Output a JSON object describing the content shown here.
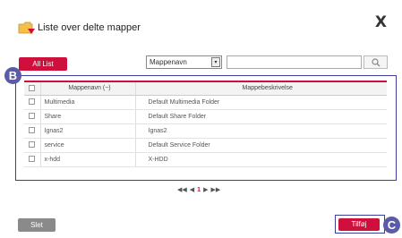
{
  "dialog": {
    "title": "Liste over delte mapper",
    "close_label": "X"
  },
  "toolbar": {
    "all_list_label": "All List",
    "filter_select_value": "Mappenavn",
    "filter_select_arrow": "▾",
    "search_value": ""
  },
  "annotations": {
    "badge_b": "B",
    "badge_c": "C"
  },
  "table": {
    "headers": {
      "name": "Mappenavn (−)",
      "description": "Mappebeskrivelse"
    },
    "rows": [
      {
        "name": "Multimedia",
        "description": "Default Multimedia Folder"
      },
      {
        "name": "Share",
        "description": "Default Share Folder"
      },
      {
        "name": "Ignas2",
        "description": "Ignas2"
      },
      {
        "name": "service",
        "description": "Default Service Folder"
      },
      {
        "name": "x-hdd",
        "description": "X-HDD"
      }
    ]
  },
  "pagination": {
    "first": "◀◀",
    "prev": "◀",
    "current": "1",
    "next": "▶",
    "last": "▶▶"
  },
  "footer": {
    "delete_label": "Slet",
    "add_label": "Tilføj"
  },
  "colors": {
    "accent": "#d0103c",
    "annotation": "#3d3d9a",
    "badge": "#5b5ba8",
    "button_gray": "#8a8a8a"
  }
}
